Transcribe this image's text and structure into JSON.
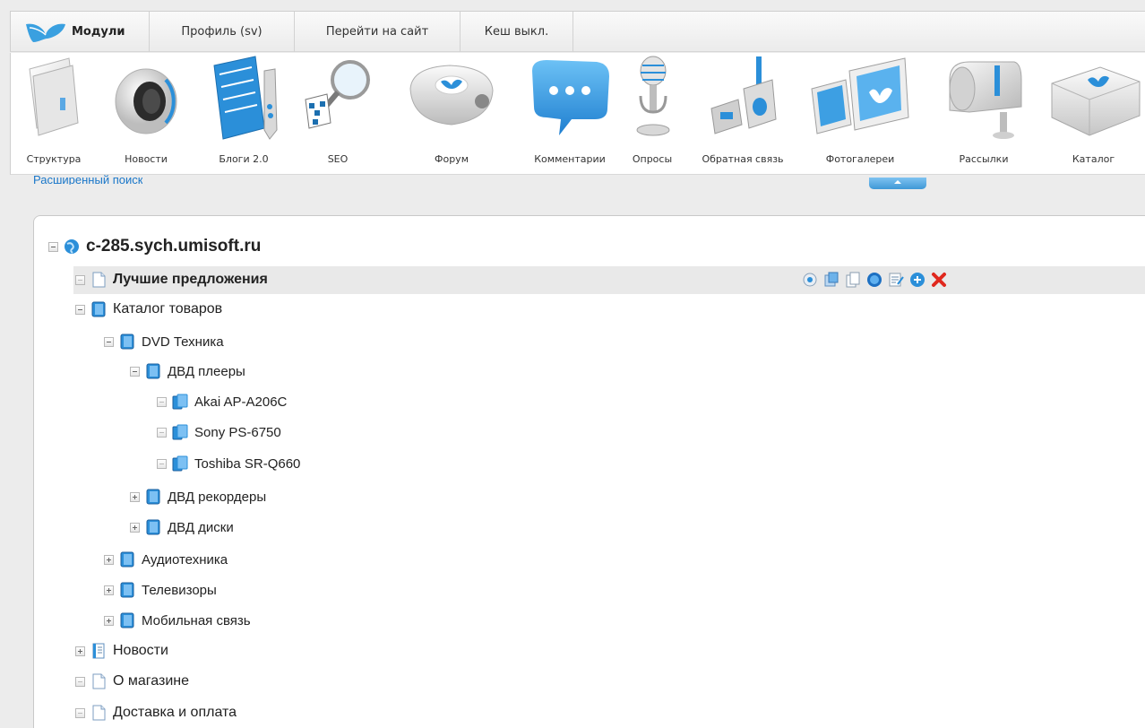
{
  "topmenu": {
    "modules_label": "Модули",
    "profile_label": "Профиль (sv)",
    "site_label": "Перейти на сайт",
    "cache_label": "Кеш выкл."
  },
  "modules": [
    {
      "label": "Структура",
      "icon": "structure-folder-icon"
    },
    {
      "label": "Новости",
      "icon": "news-speaker-icon"
    },
    {
      "label": "Блоги 2.0",
      "icon": "blogs-notebook-icon"
    },
    {
      "label": "SEO",
      "icon": "seo-magnifier-icon"
    },
    {
      "label": "Форум",
      "icon": "forum-projector-icon"
    },
    {
      "label": "Комментарии",
      "icon": "comments-bubble-icon"
    },
    {
      "label": "Опросы",
      "icon": "polls-microphone-icon"
    },
    {
      "label": "Обратная связь",
      "icon": "feedback-phone-icon"
    },
    {
      "label": "Фотогалереи",
      "icon": "photo-galleries-icon"
    },
    {
      "label": "Рассылки",
      "icon": "mailbox-icon"
    },
    {
      "label": "Каталог",
      "icon": "catalog-box-icon"
    }
  ],
  "search": {
    "advanced_label": "Расширенный поиск"
  },
  "tree": {
    "root": "c-285.sych.umisoft.ru",
    "items": [
      {
        "label": "Лучшие предложения"
      },
      {
        "label": "Каталог товаров"
      },
      {
        "label": "DVD Техника"
      },
      {
        "label": "ДВД плееры"
      },
      {
        "label": "Akai AP-A206C"
      },
      {
        "label": "Sony PS-6750"
      },
      {
        "label": "Toshiba SR-Q660"
      },
      {
        "label": "ДВД рекордеры"
      },
      {
        "label": "ДВД диски"
      },
      {
        "label": "Аудиотехника"
      },
      {
        "label": "Телевизоры"
      },
      {
        "label": "Мобильная связь"
      },
      {
        "label": "Новости"
      },
      {
        "label": "О магазине"
      },
      {
        "label": "Доставка и оплата"
      }
    ]
  },
  "row_actions": [
    "view-icon",
    "edit-icon",
    "copy-icon",
    "activity-icon",
    "properties-icon",
    "add-icon",
    "delete-icon"
  ],
  "colors": {
    "accent": "#2b8fd9",
    "delete": "#e0281e"
  }
}
